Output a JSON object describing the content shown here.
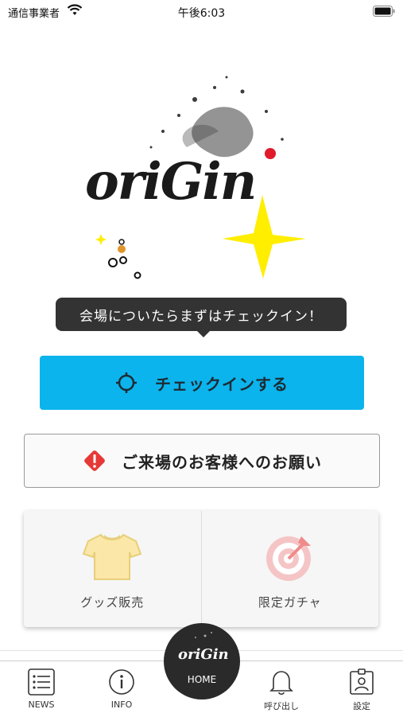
{
  "status_bar": {
    "carrier": "通信事業者",
    "time": "午後6:03"
  },
  "logo": {
    "text": "oriGin"
  },
  "tooltip": {
    "text": "会場についたらまずはチェックイン！"
  },
  "checkin_button": {
    "label": "チェックインする",
    "color": "#0bb4ec"
  },
  "notice_button": {
    "label": "ご来場のお客様へのお願い",
    "icon_color": "#e53935"
  },
  "tiles": [
    {
      "label": "グッズ販売",
      "icon": "tshirt-icon"
    },
    {
      "label": "限定ガチャ",
      "icon": "target-icon"
    }
  ],
  "tabbar": {
    "news": "NEWS",
    "info": "INFO",
    "home": "HOME",
    "call": "呼び出し",
    "settings": "設定"
  }
}
